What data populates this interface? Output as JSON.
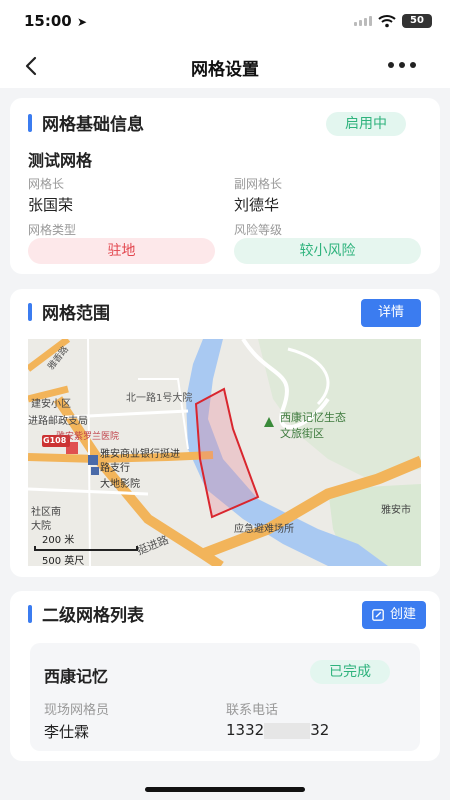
{
  "status_bar": {
    "time": "15:00",
    "battery": "50"
  },
  "nav": {
    "title": "网格设置"
  },
  "basic_info": {
    "section_title": "网格基础信息",
    "status": "启用中",
    "grid_name": "测试网格",
    "leader_label": "网格长",
    "leader_value": "张国荣",
    "deputy_label": "副网格长",
    "deputy_value": "刘德华",
    "type_label": "网格类型",
    "type_value": "驻地",
    "risk_label": "风险等级",
    "risk_value": "较小风险"
  },
  "range": {
    "section_title": "网格范围",
    "detail_button": "详情",
    "map": {
      "labels": {
        "road_north": "北一路1号大院",
        "park_line1": "西康记忆生态",
        "park_line2": "文旅街区",
        "hospital": "雅安紫罗兰医院",
        "bank_line1": "雅安商业银行挺进",
        "bank_line2": "路支行",
        "cinema": "大地影院",
        "shelter": "应急避难场所",
        "road_tingjin": "挺进路",
        "road_yaan": "雅安市",
        "left1": "建安小区",
        "left2": "进路邮政支局",
        "left3": "社区南",
        "left4": "大院",
        "road_left": "雅香路",
        "highway": "G108"
      },
      "scale_metric": "200 米",
      "scale_imperial": "500 英尺"
    }
  },
  "sub_grid": {
    "section_title": "二级网格列表",
    "create_button": "创建",
    "items": [
      {
        "name": "西康记忆",
        "status": "已完成",
        "staff_label": "现场网格员",
        "staff_value": "李仕霖",
        "phone_label": "联系电话",
        "phone_prefix": "1332",
        "phone_suffix": "32"
      }
    ]
  },
  "colors": {
    "accent": "#3b7cf0",
    "success": "#2fb37d",
    "danger": "#e2474f",
    "boundary": "#d9262e"
  }
}
